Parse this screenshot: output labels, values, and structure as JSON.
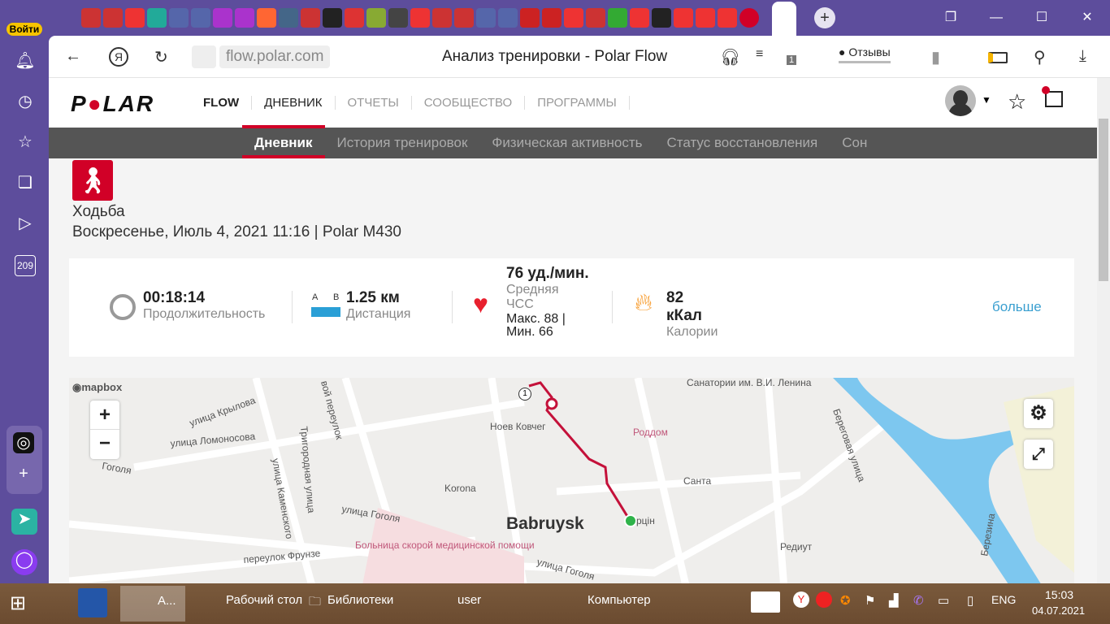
{
  "sidebar": {
    "login": "Войти",
    "badge": "209"
  },
  "browser": {
    "url": "flow.polar.com",
    "title": "Анализ тренировки - Polar Flow",
    "reviews": "Отзывы",
    "badge": "1"
  },
  "header": {
    "brand": "POLAR",
    "product": "FLOW",
    "nav": [
      "ДНЕВНИК",
      "ОТЧЕТЫ",
      "СООБЩЕСТВО",
      "ПРОГРАММЫ"
    ]
  },
  "subnav": [
    "Дневник",
    "История тренировок",
    "Физическая активность",
    "Статус восстановления",
    "Сон"
  ],
  "training": {
    "sport": "Ходьба",
    "date": "Воскресенье, Июль 4, 2021 11:16 | Polar M430"
  },
  "summary": {
    "duration": {
      "value": "00:18:14",
      "label": "Продолжительность"
    },
    "distance": {
      "value": "1.25 км",
      "label": "Дистанция",
      "a": "A",
      "b": "B"
    },
    "hr": {
      "value": "76 уд./мин.",
      "label1": "Средняя",
      "label2": "ЧСС",
      "max": "Макс. 88  |",
      "min": "Мин. 66"
    },
    "calories": {
      "value": "82 кКал",
      "label": "Калории"
    },
    "more": "больше"
  },
  "map": {
    "attribution": "mapbox",
    "zoom_in": "+",
    "zoom_out": "−",
    "lap": "1",
    "labels": [
      "улица Крылова",
      "улица Каменского",
      "Тригородная улица",
      "вой переулок",
      "улица Ломоносова",
      "Гоголя",
      "Ноев Ковчег",
      "Роддом",
      "Санатории им. В.И. Ленина",
      "Береговая улица",
      "Korona",
      "Санта",
      "улица Гоголя",
      "Babruysk",
      "рцін",
      "Больница скорой медицинской помощи",
      "переулок Фрунзе",
      "Редиут",
      "улица Гоголя",
      "Березина"
    ]
  },
  "taskbar": {
    "app": "А...",
    "desktop": "Рабочий стол",
    "libraries": "Библиотеки",
    "user": "user",
    "computer": "Компьютер",
    "lang": "ENG",
    "time": "15:03",
    "date": "04.07.2021"
  }
}
